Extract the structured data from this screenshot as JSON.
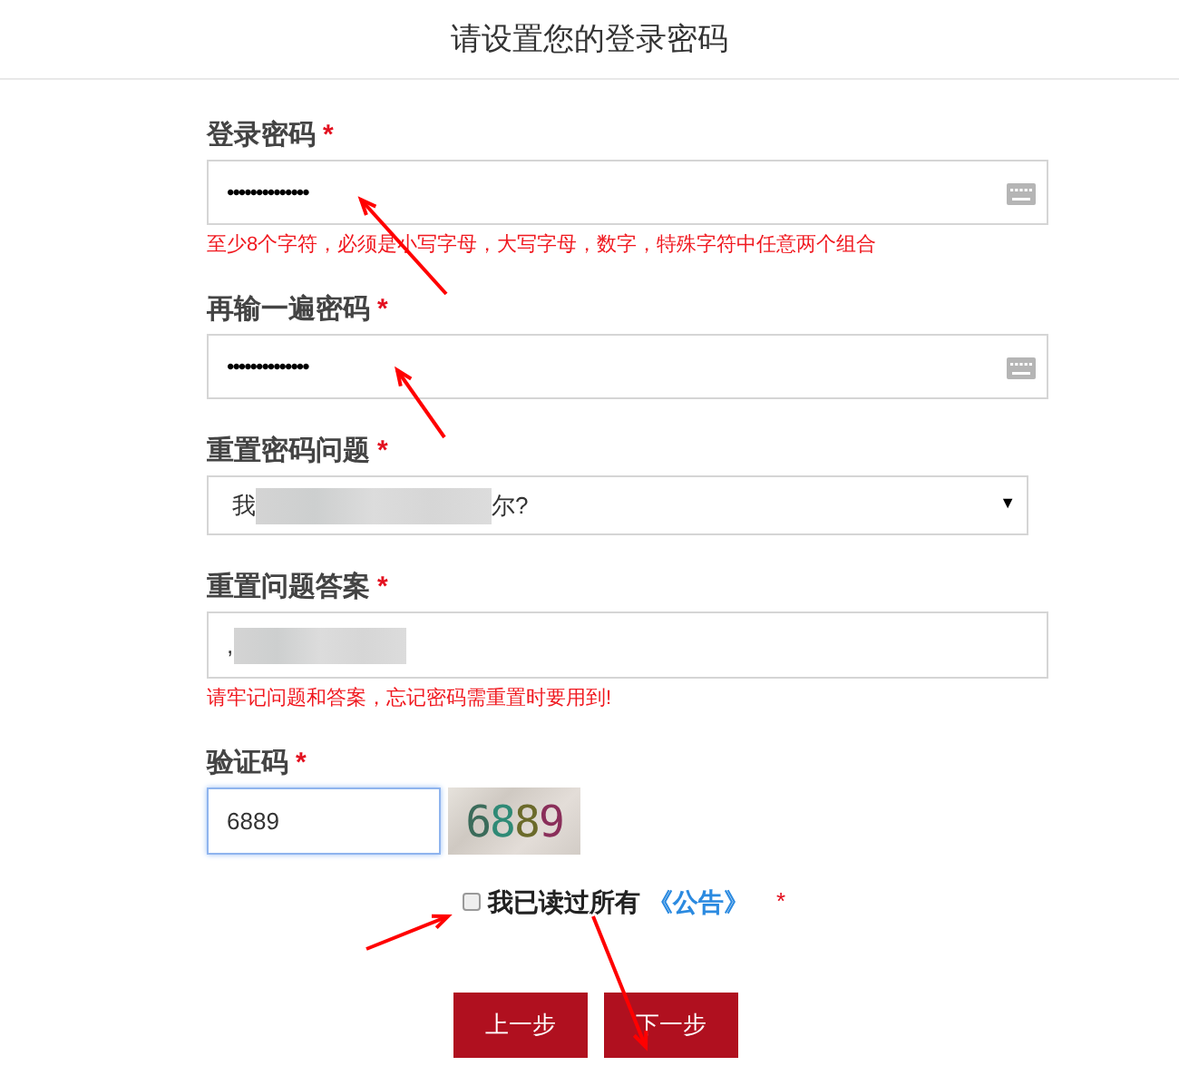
{
  "title": "请设置您的登录密码",
  "fields": [
    {
      "kind": "password",
      "label": "登录密码",
      "required": "*",
      "value": "••••••••••••••",
      "hint": "至少8个字符，必须是小写字母，大写字母，数字，特殊字符中任意两个组合"
    },
    {
      "kind": "password",
      "label": "再输一遍密码",
      "required": "*",
      "value": "••••••••••••••"
    },
    {
      "kind": "select",
      "label": "重置密码问题",
      "required": "*",
      "value_start": "我",
      "value_end": "尔?",
      "caret": "▼"
    },
    {
      "kind": "answer",
      "label": "重置问题答案",
      "required": "*",
      "value_start": ",",
      "hint": "请牢记问题和答案，忘记密码需重置时要用到!"
    },
    {
      "kind": "captcha",
      "label": "验证码",
      "required": "*",
      "value": "6889",
      "captcha": "6889",
      "focused": true
    }
  ],
  "agreement": {
    "checked": false,
    "text": "我已读过所有",
    "link": "《公告》",
    "required": "*"
  },
  "buttons": [
    "上一步",
    "下一步"
  ]
}
